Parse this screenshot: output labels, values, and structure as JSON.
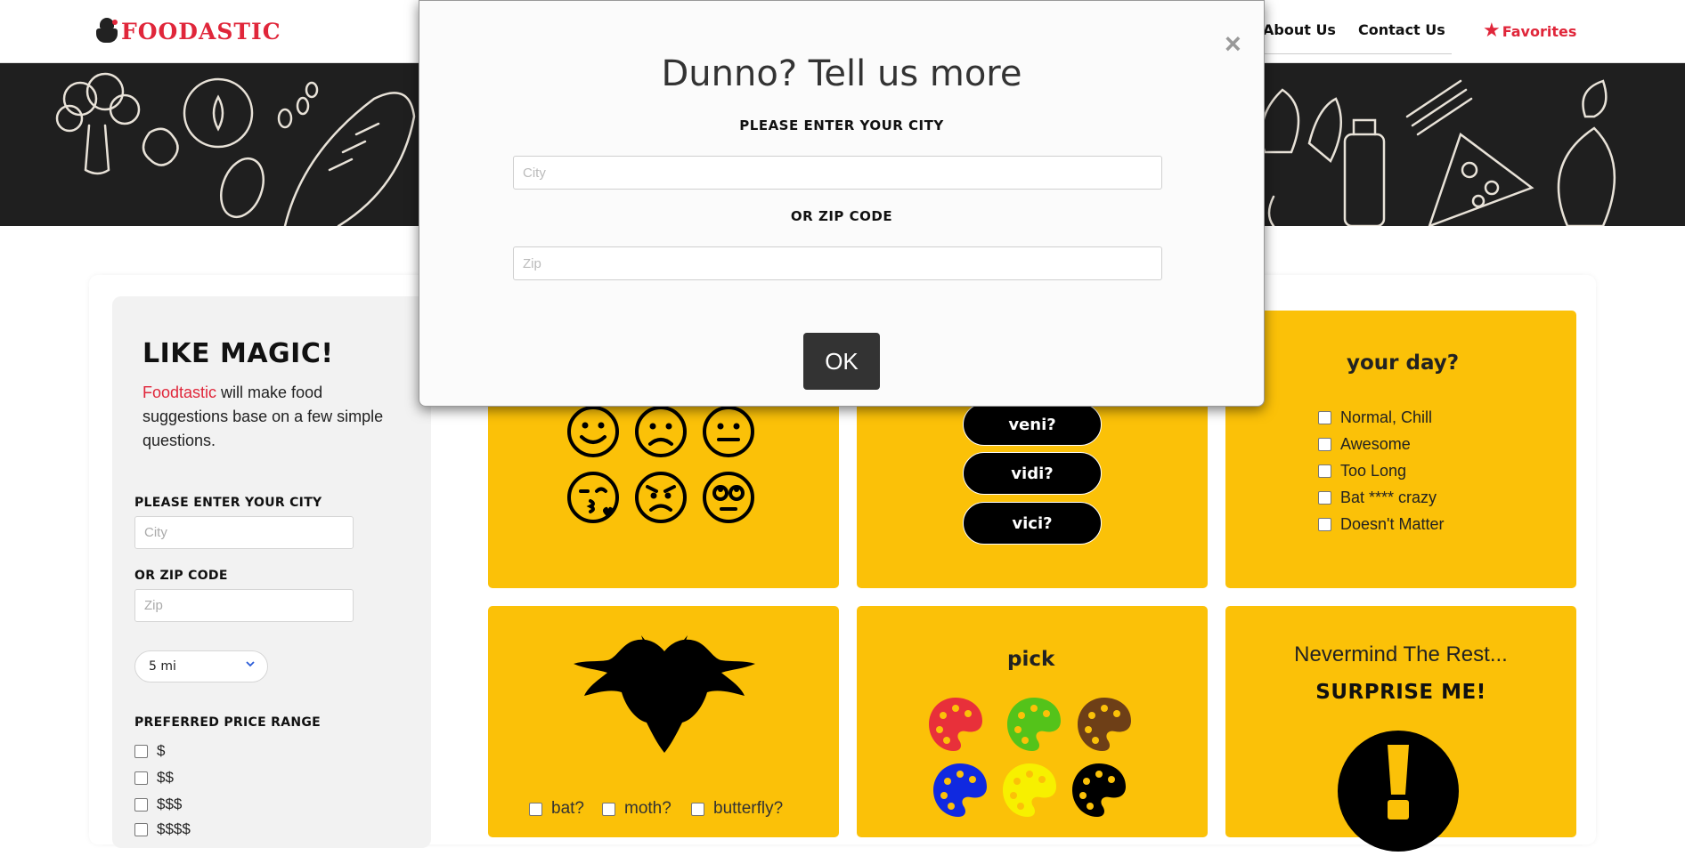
{
  "nav": {
    "logo_text": "FOODASTIC",
    "about": "About Us",
    "contact": "Contact Us",
    "favorites": "Favorites"
  },
  "sidebar": {
    "title": "LIKE MAGIC!",
    "brand": "Foodtastic",
    "desc_rest": " will make food suggestions base on a few simple questions.",
    "city_label": "PLEASE ENTER YOUR CITY",
    "city_placeholder": "City",
    "zip_label": "OR ZIP CODE",
    "zip_placeholder": "Zip",
    "distance": "5 mi",
    "price_label": "PREFERRED PRICE RANGE",
    "prices": [
      "$",
      "$$",
      "$$$",
      "$$$$"
    ]
  },
  "cards": {
    "day_title": "your day?",
    "day_options": [
      "Normal, Chill",
      "Awesome",
      "Too Long",
      "Bat **** crazy",
      "Doesn't Matter"
    ],
    "pills": [
      "veni?",
      "vidi?",
      "vici?"
    ],
    "bug_options": [
      "bat?",
      "moth?",
      "butterfly?"
    ],
    "pick_title": "pick",
    "palette_colors": [
      "#e8303a",
      "#54c31a",
      "#6e3f17",
      "#1029e0",
      "#f7f000",
      "#000000"
    ],
    "never_text": "Nevermind The Rest...",
    "surprise_text": "SURPRISE ME!"
  },
  "modal": {
    "title": "Dunno? Tell us more",
    "city_label": "PLEASE ENTER YOUR CITY",
    "city_placeholder": "City",
    "zip_label": "OR ZIP CODE",
    "zip_placeholder": "Zip",
    "ok": "OK",
    "close": "×"
  },
  "colors": {
    "accent_red": "#e0263a",
    "card_yellow": "#fbc108",
    "hero_dark": "#1f1f1f",
    "button_dark": "#333333"
  }
}
